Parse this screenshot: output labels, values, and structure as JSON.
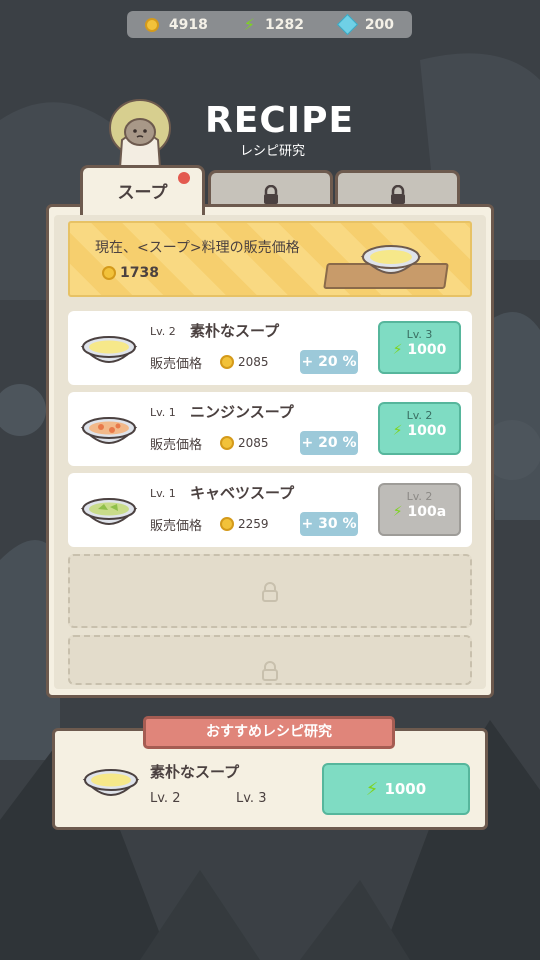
{
  "currency": {
    "coins": "4918",
    "energy": "1282",
    "gems": "200",
    "coin_icon": "coin-icon",
    "energy_icon": "lightning-icon",
    "gem_icon": "gem-icon"
  },
  "header": {
    "title": "RECIPE",
    "subtitle": "レシピ研究"
  },
  "tabs": [
    {
      "label": "スープ",
      "locked": false,
      "notification": true
    },
    {
      "label": "",
      "locked": true
    },
    {
      "label": "",
      "locked": true
    }
  ],
  "banner": {
    "label": "現在、<スープ>料理の販売価格",
    "value": "1738"
  },
  "recipes": [
    {
      "level": "Lv. 2",
      "name": "素朴なスープ",
      "sale_label": "販売価格",
      "price": "2085",
      "bonus": "+ 20 %",
      "next_level": "Lv. 3",
      "cost": "1000",
      "available": true,
      "soup": "plain"
    },
    {
      "level": "Lv. 1",
      "name": "ニンジンスープ",
      "sale_label": "販売価格",
      "price": "2085",
      "bonus": "+ 20 %",
      "next_level": "Lv. 2",
      "cost": "1000",
      "available": true,
      "soup": "carrot"
    },
    {
      "level": "Lv. 1",
      "name": "キャベツスープ",
      "sale_label": "販売価格",
      "price": "2259",
      "bonus": "+ 30 %",
      "next_level": "Lv. 2",
      "cost": "100a",
      "available": false,
      "soup": "cabbage"
    }
  ],
  "recommendation": {
    "header": "おすすめレシピ研究",
    "name": "素朴なスープ",
    "level_from": "Lv. 2",
    "level_to": "Lv. 3",
    "cost": "1000"
  },
  "colors": {
    "background": "#3b4045",
    "panel": "#f5f0e2",
    "accent_green": "#7fdcc3",
    "bonus_blue": "#9cc9d9",
    "notification_red": "#e35a4f",
    "coin_gold": "#f2c23a"
  }
}
